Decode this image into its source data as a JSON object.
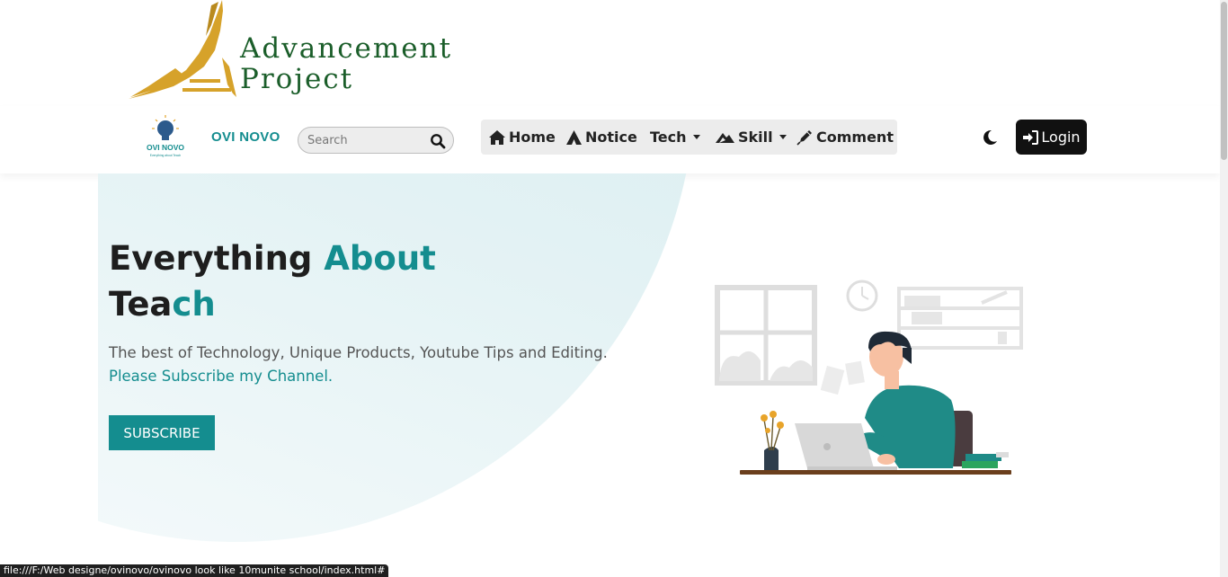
{
  "banner": {
    "line1": "Advancement",
    "line2": "Project"
  },
  "navbar": {
    "brand_logo_text": "OVI NOVO",
    "brand_logo_tagline": "Everything about Teach",
    "brand_name": "OVI NOVO",
    "search": {
      "placeholder": "Search",
      "value": ""
    },
    "menu": [
      {
        "label": "Home",
        "icon": "home-icon"
      },
      {
        "label": "Notice",
        "icon": "notice-icon"
      },
      {
        "label": "Tech",
        "icon": "",
        "dropdown": true
      },
      {
        "label": "Skill",
        "icon": "skill-icon",
        "dropdown": true
      },
      {
        "label": "Comment",
        "icon": "comment-icon"
      }
    ],
    "theme_toggle_icon": "moon-icon",
    "login_label": "Login"
  },
  "hero": {
    "title_part1": "Everything ",
    "title_accent1": "About",
    "title_part2": "Tea",
    "title_accent2": "ch",
    "description": "The best of Technology, Unique Products, Youtube Tips and Editing.",
    "description_accent": "Please Subscribe my Channel.",
    "subscribe_label": "SUBSCRIBE"
  },
  "status_bar": {
    "url": "file:///F:/Web designe/ovinovo/ovinovo look like 10munite school/index.html#"
  },
  "colors": {
    "accent": "#148d8f",
    "banner_green": "#1b5e2a",
    "banner_gold": "#d6a22a",
    "login_bg": "#111111"
  }
}
